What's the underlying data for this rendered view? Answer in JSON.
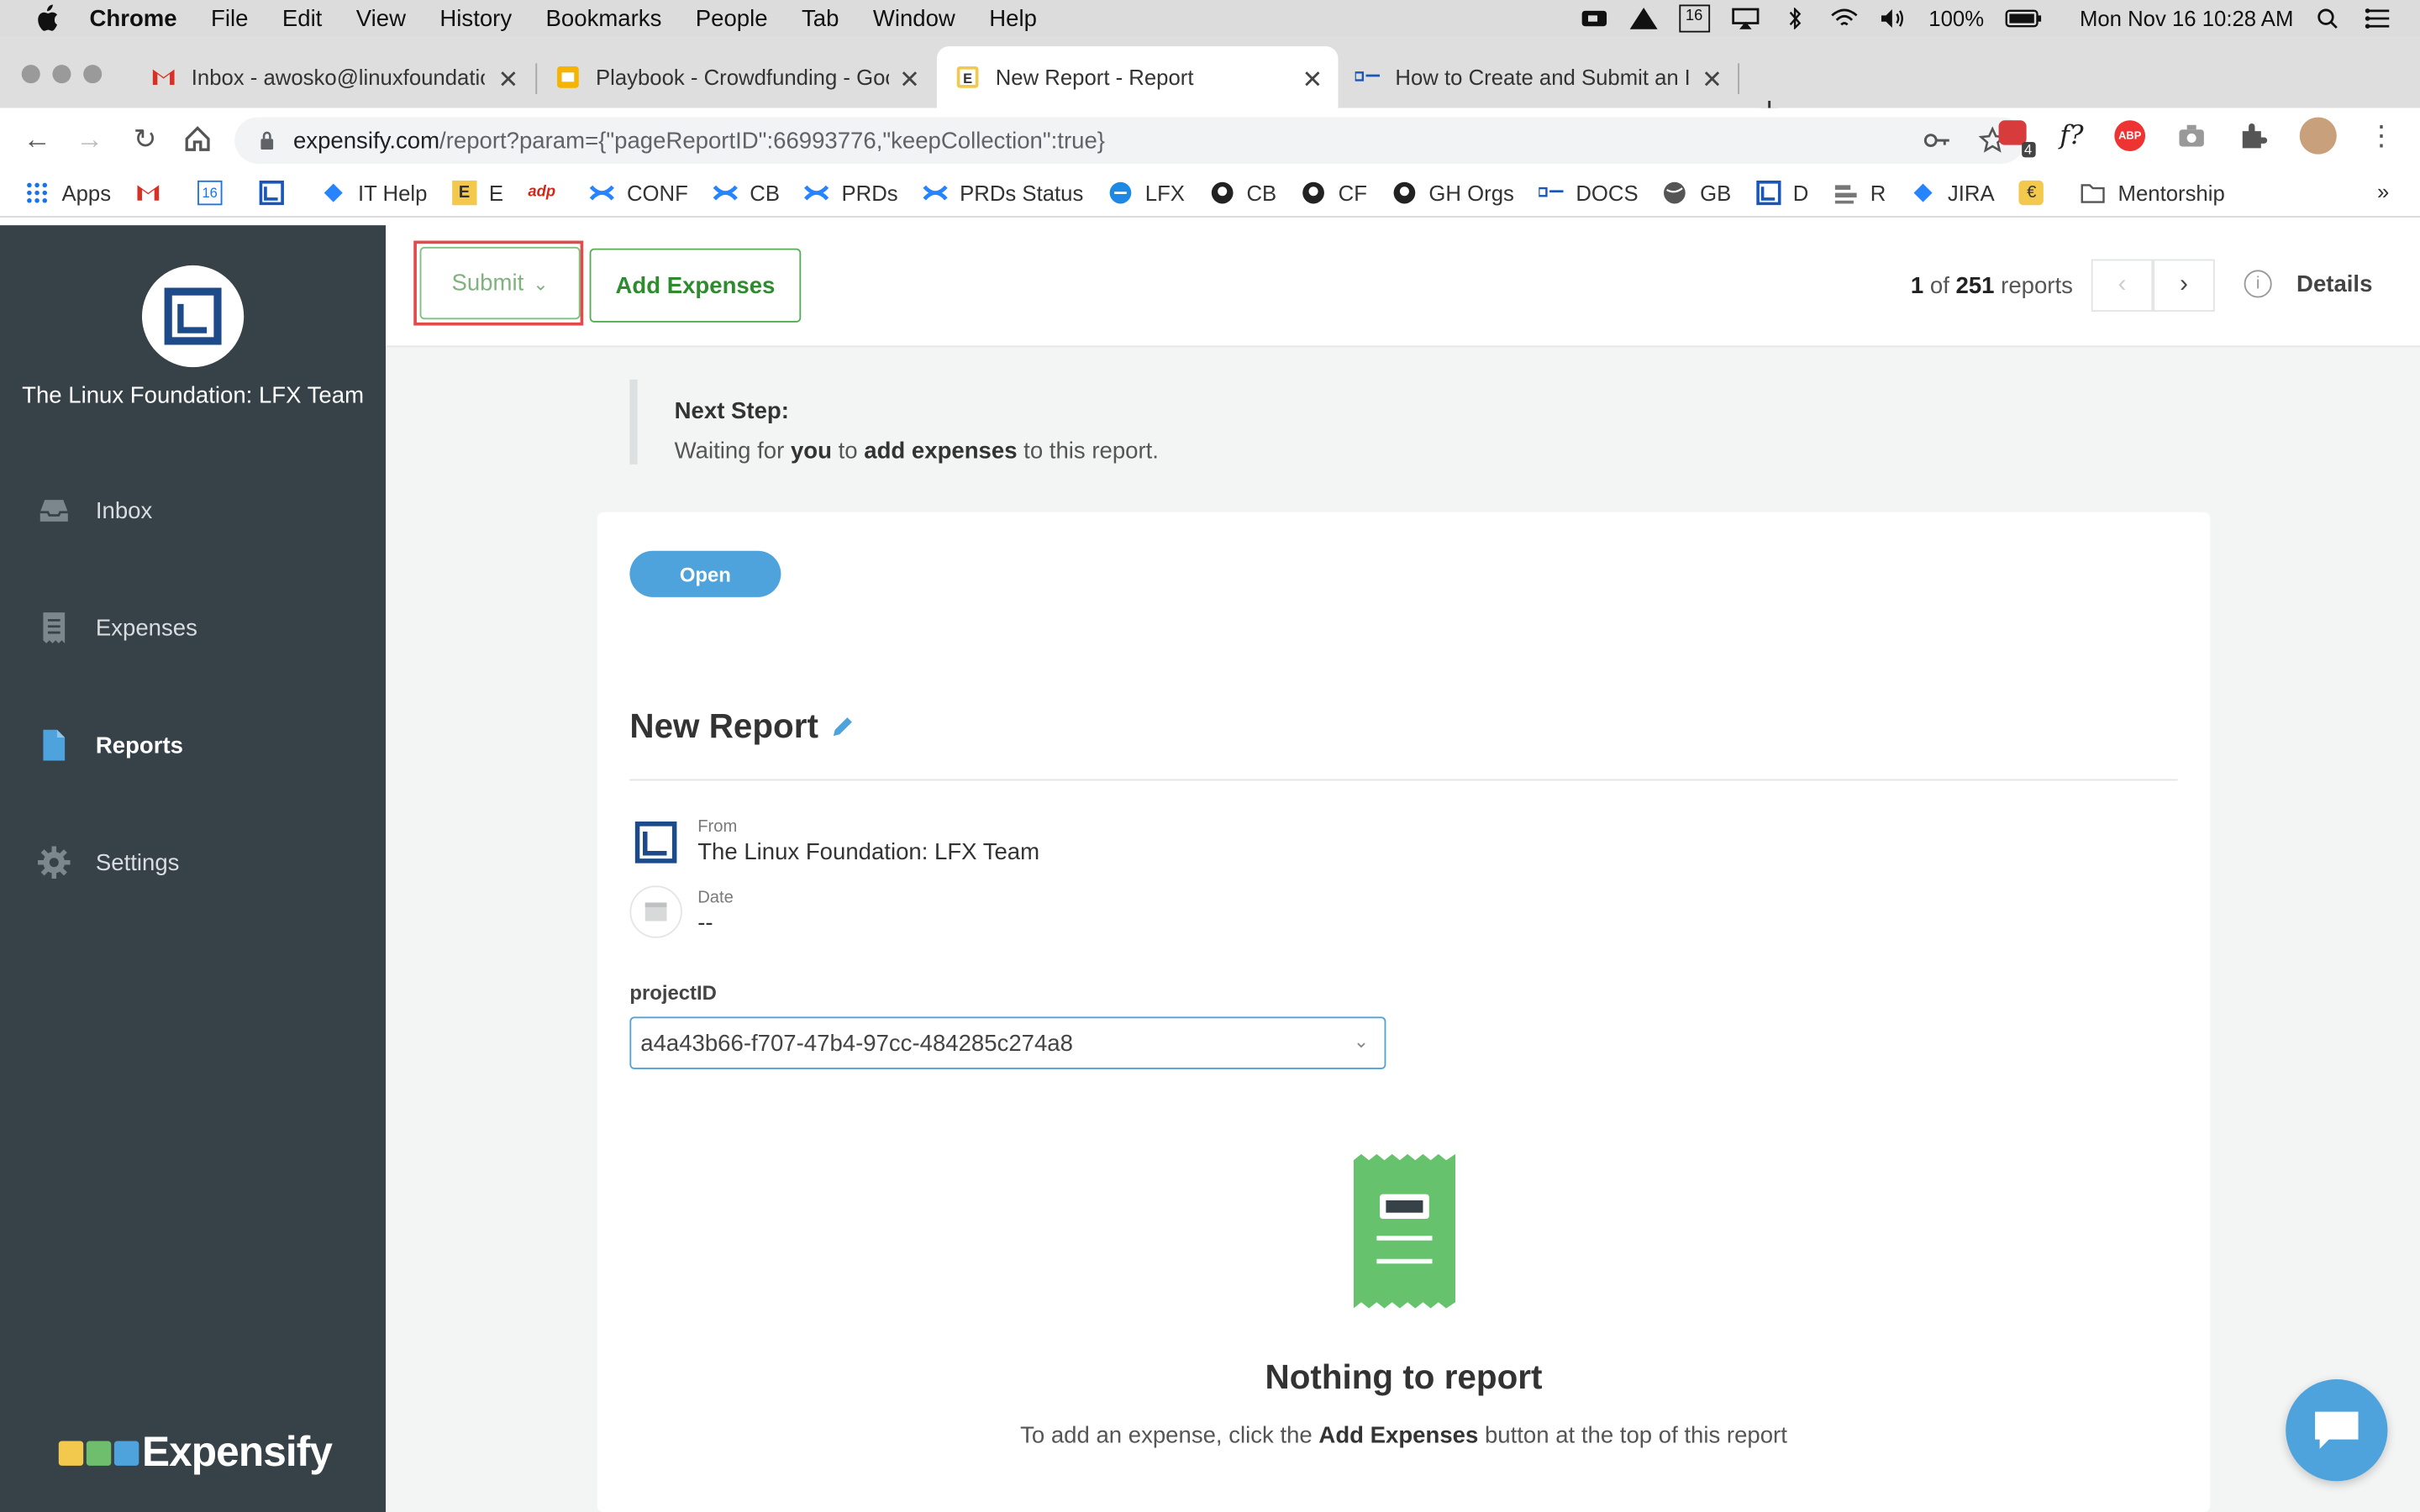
{
  "menubar": {
    "app_name": "Chrome",
    "items": [
      "File",
      "Edit",
      "View",
      "History",
      "Bookmarks",
      "People",
      "Tab",
      "Window",
      "Help"
    ],
    "battery": "100%",
    "datetime": "Mon Nov 16  10:28 AM",
    "calendar_day": "16"
  },
  "tabs": [
    {
      "title": "Inbox - awosko@linuxfoundatio",
      "active": false
    },
    {
      "title": "Playbook - Crowdfunding - Goo",
      "active": false
    },
    {
      "title": "New Report - Report",
      "active": true
    },
    {
      "title": "How to Create and Submit an E",
      "active": false
    }
  ],
  "address": {
    "host": "expensify.com",
    "path": "/report?param={\"pageReportID\":66993776,\"keepCollection\":true}"
  },
  "extensions": {
    "badge_count": "4",
    "formula_label": "f?",
    "abp_label": "ABP"
  },
  "bookmarks": [
    "Apps",
    "",
    "",
    "",
    "IT Help",
    "E",
    "",
    "CONF",
    "CB",
    "PRDs",
    "PRDs Status",
    "LFX",
    "CB",
    "CF",
    "GH Orgs",
    "DOCS",
    "GB",
    "D",
    "R",
    "JIRA",
    "",
    "Mentorship"
  ],
  "bookmarks_more": "»",
  "sidebar": {
    "org_name": "The Linux Foundation: LFX Team",
    "items": [
      {
        "label": "Inbox",
        "icon": "inbox-icon"
      },
      {
        "label": "Expenses",
        "icon": "receipt-icon"
      },
      {
        "label": "Reports",
        "icon": "document-icon"
      },
      {
        "label": "Settings",
        "icon": "gear-icon"
      }
    ],
    "brand": "Expensify"
  },
  "toolbar": {
    "submit_label": "Submit",
    "add_expenses_label": "Add Expenses",
    "report_index": "1",
    "report_total": "251",
    "report_count_of": "of",
    "report_count_suffix": "reports",
    "details_label": "Details"
  },
  "next_step": {
    "title": "Next Step:",
    "body_pre": "Waiting for ",
    "body_you": "you",
    "body_mid": " to ",
    "body_action": "add expenses",
    "body_post": " to this report."
  },
  "report": {
    "status": "Open",
    "title": "New Report",
    "from_label": "From",
    "from_value": "The Linux Foundation: LFX Team",
    "date_label": "Date",
    "date_value": "--",
    "project_label": "projectID",
    "project_value": "a4a43b66-f707-47b4-97cc-484285c274a8",
    "empty_title": "Nothing to report",
    "empty_pre": "To add an expense, click the ",
    "empty_button": "Add Expenses",
    "empty_post": " button at the top of this report"
  },
  "colors": {
    "sidebar_bg": "#364148",
    "accent_blue": "#4fa3dd",
    "accent_green": "#56ad56",
    "highlight_red": "#e04b4b"
  }
}
